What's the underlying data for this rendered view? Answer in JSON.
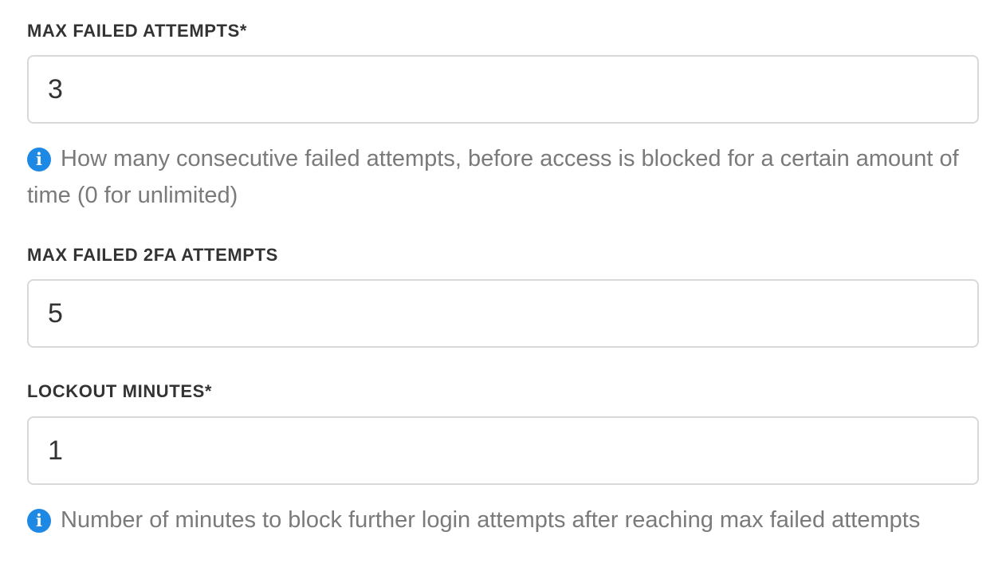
{
  "fields": [
    {
      "label": "MAX FAILED ATTEMPTS*",
      "value": "3",
      "help": "How many consecutive failed attempts, before access is blocked for a certain amount of time (0 for unlimited)",
      "help_icon": "info-icon"
    },
    {
      "label": "MAX FAILED 2FA ATTEMPTS",
      "value": "5"
    },
    {
      "label": "LOCKOUT MINUTES*",
      "value": "1",
      "help": "Number of minutes to block further login attempts after reaching max failed attempts",
      "help_icon": "info-icon"
    }
  ],
  "colors": {
    "info_icon": "#1e88e5",
    "help_text": "#7a7a7a",
    "input_border": "#d9d9d9"
  }
}
